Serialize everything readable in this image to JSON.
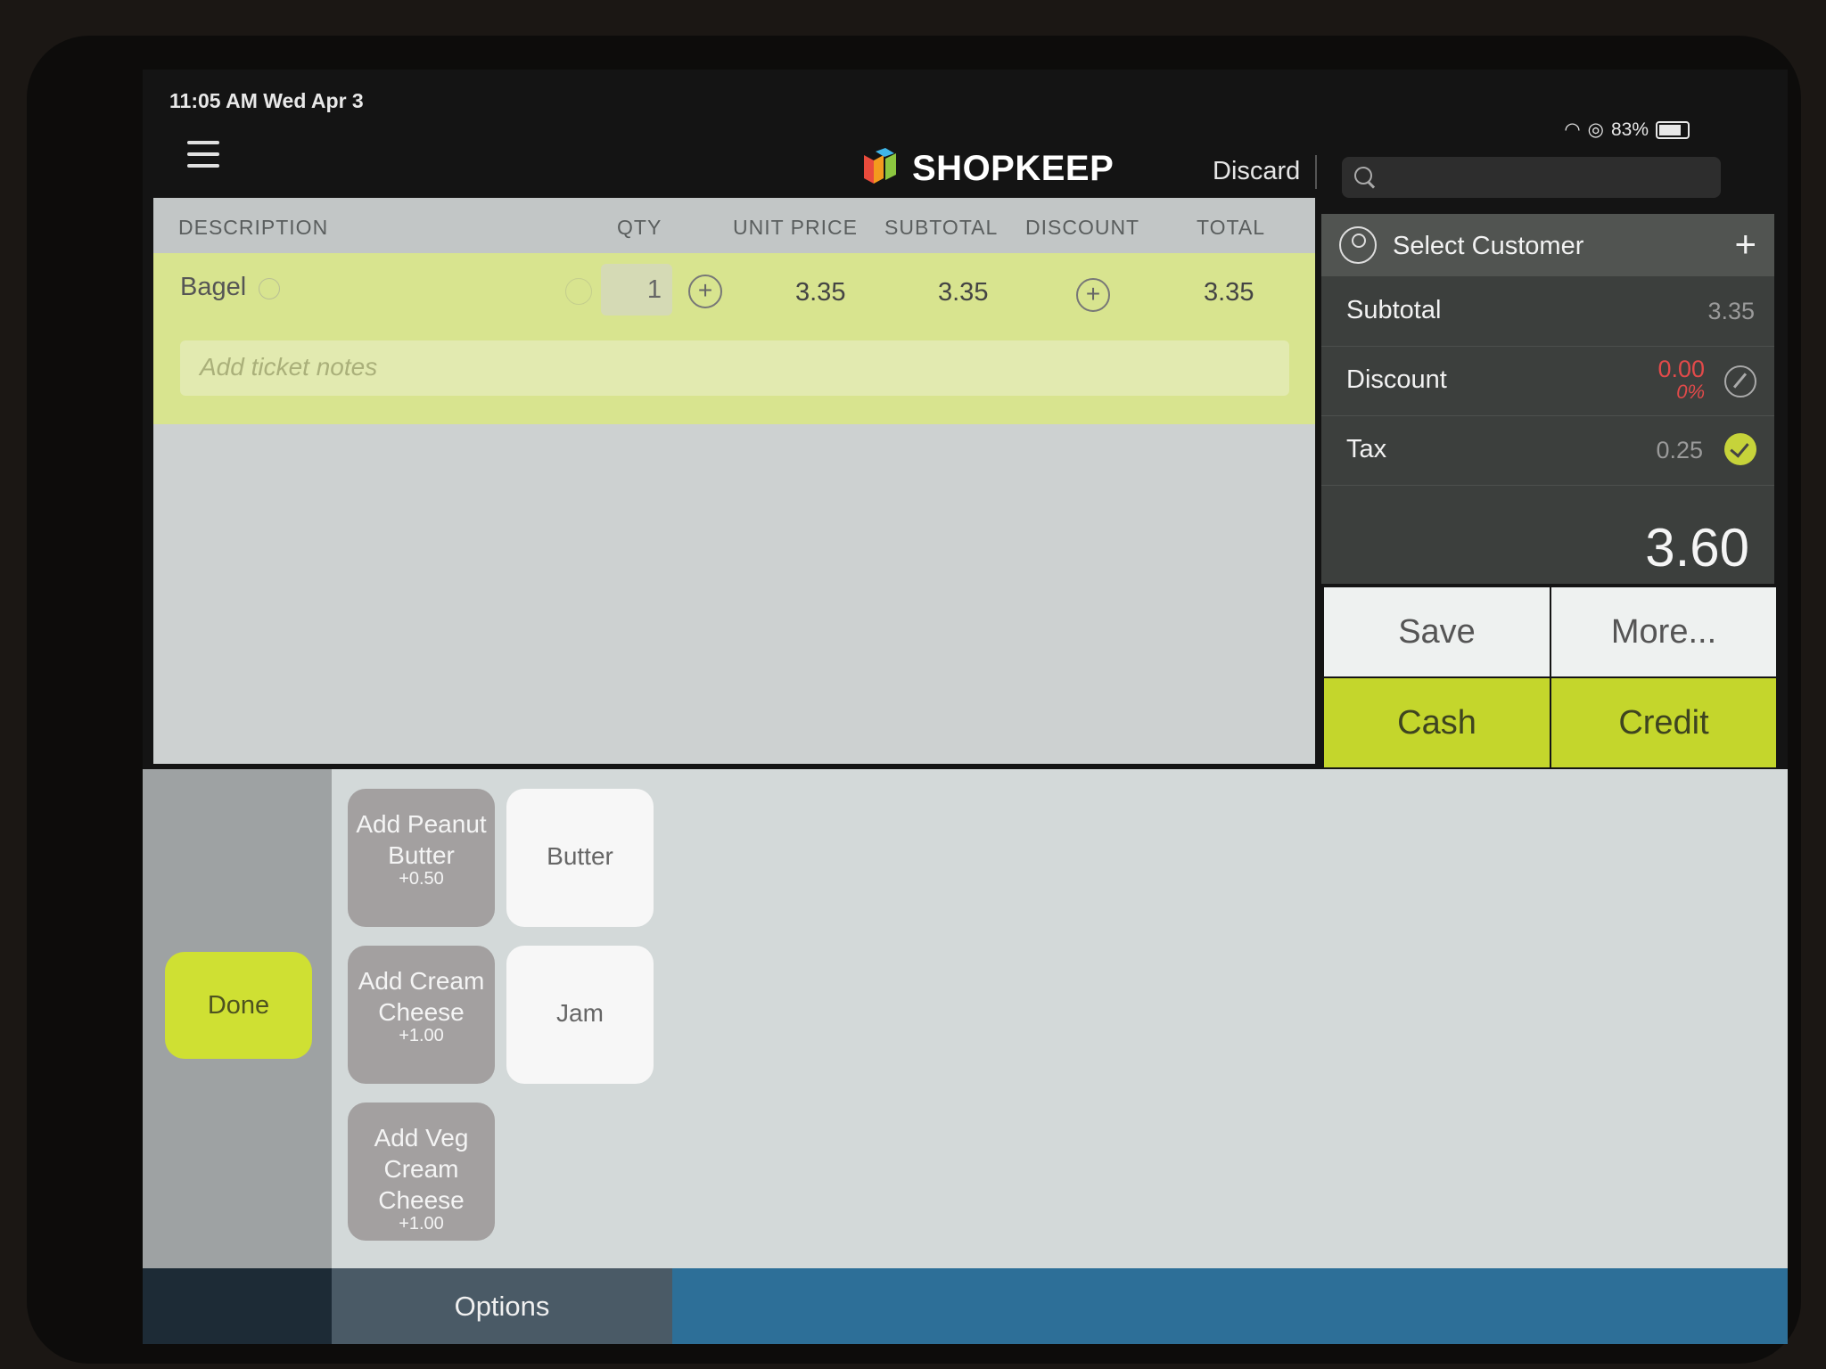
{
  "status": {
    "time": "11:05 AM   Wed Apr 3",
    "battery": "83%"
  },
  "nav": {
    "brand": "SHOPKEEP",
    "discard": "Discard",
    "search_placeholder": ""
  },
  "table": {
    "headers": [
      "DESCRIPTION",
      "QTY",
      "UNIT PRICE",
      "SUBTOTAL",
      "DISCOUNT",
      "TOTAL"
    ],
    "item": {
      "name": "Bagel",
      "qty": "1",
      "unit_price": "3.35",
      "subtotal": "3.35",
      "total": "3.35"
    },
    "notes_placeholder": "Add ticket notes"
  },
  "summary": {
    "customer": "Select Customer",
    "subtotal_label": "Subtotal",
    "subtotal": "3.35",
    "discount_label": "Discount",
    "discount": "0.00",
    "discount_pct": "0%",
    "tax_label": "Tax",
    "tax": "0.25",
    "total": "3.60"
  },
  "actions": {
    "save": "Save",
    "more": "More...",
    "cash": "Cash",
    "credit": "Credit"
  },
  "modifiers": {
    "done": "Done",
    "items": [
      {
        "label": "Add Peanut Butter",
        "price": "+0.50"
      },
      {
        "label": "Butter"
      },
      {
        "label": "Add Cream Cheese",
        "price": "+1.00"
      },
      {
        "label": "Jam"
      },
      {
        "label": "Add Veg Cream Cheese",
        "price": "+1.00"
      }
    ],
    "options_tab": "Options"
  },
  "colors": {
    "accent_green": "#c4d62c",
    "row_highlight": "#d8e48f",
    "discount_red": "#e24a4a"
  }
}
